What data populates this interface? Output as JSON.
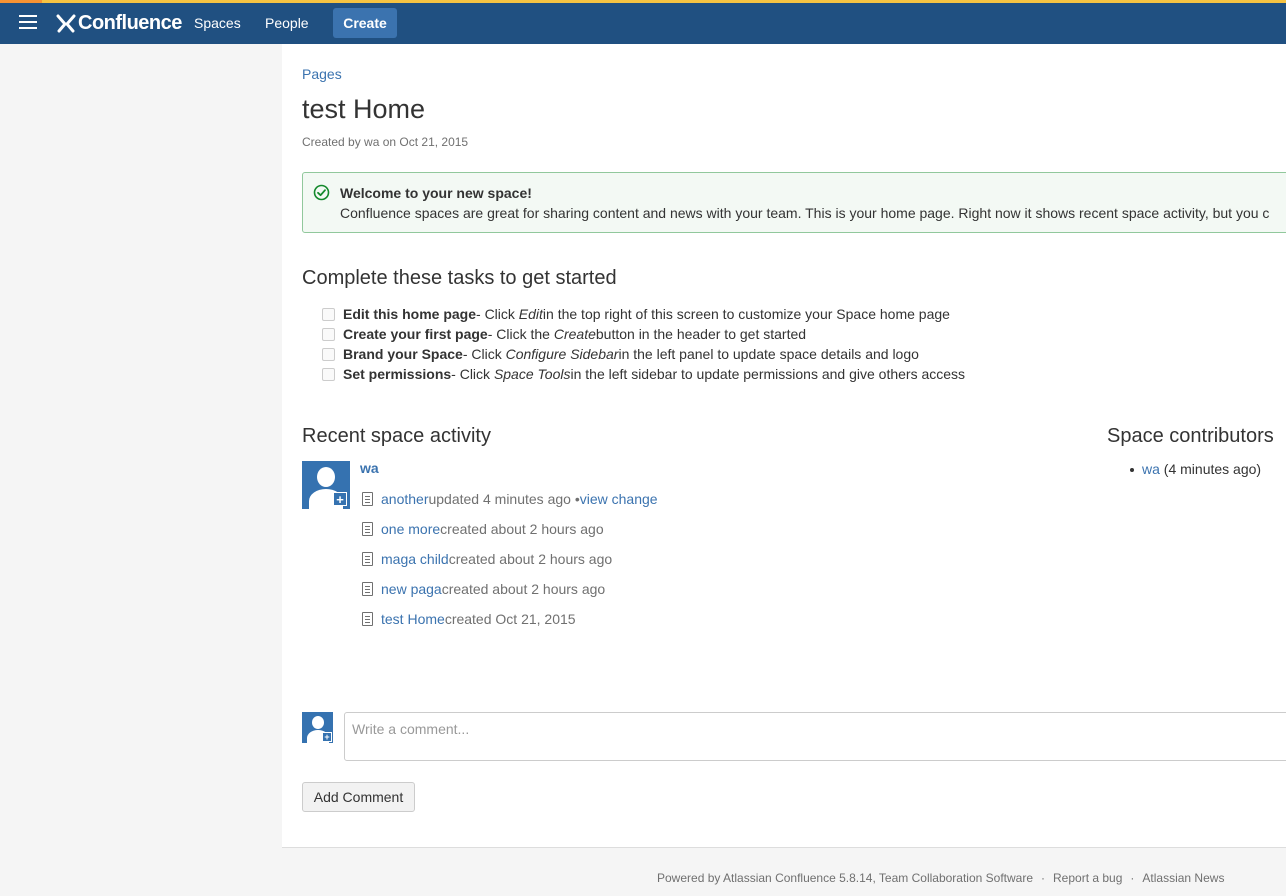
{
  "header": {
    "logo_text": "Confluence",
    "nav": [
      "Spaces",
      "People"
    ],
    "create_label": "Create"
  },
  "breadcrumb": "Pages",
  "page": {
    "title": "test Home",
    "meta": "Created by wa on Oct 21, 2015"
  },
  "welcome": {
    "title": "Welcome to your new space!",
    "body": "Confluence spaces are great for sharing content and news with your team. This is your home page. Right now it shows recent space activity, but you c"
  },
  "tasks": {
    "heading": "Complete these tasks to get started",
    "items": [
      {
        "bold": "Edit this home page",
        "pre": " - Click ",
        "em": "Edit",
        "post": " in the top right of this screen to customize your Space home page"
      },
      {
        "bold": "Create your first page",
        "pre": " - Click the ",
        "em": "Create",
        "post": " button in the header to get started"
      },
      {
        "bold": "Brand your Space",
        "pre": " - Click ",
        "em": "Configure Sidebar",
        "post": " in the left panel to update space details and logo"
      },
      {
        "bold": "Set permissions",
        "pre": " - Click ",
        "em": "Space Tools",
        "post": " in the left sidebar to update permissions and give others access"
      }
    ]
  },
  "activity": {
    "heading": "Recent space activity",
    "user": "wa",
    "items": [
      {
        "link": "another",
        "text": " updated 4 minutes ago • ",
        "extra_link": "view change"
      },
      {
        "link": "one more",
        "text": " created about 2 hours ago",
        "extra_link": ""
      },
      {
        "link": "maga child",
        "text": " created about 2 hours ago",
        "extra_link": ""
      },
      {
        "link": "new paga",
        "text": " created about 2 hours ago",
        "extra_link": ""
      },
      {
        "link": "test Home",
        "text": " created Oct 21, 2015",
        "extra_link": ""
      }
    ]
  },
  "contributors": {
    "heading": "Space contributors",
    "items": [
      {
        "name": "wa",
        "when": " (4 minutes ago)"
      }
    ]
  },
  "comment": {
    "placeholder": "Write a comment...",
    "button": "Add Comment"
  },
  "footer": {
    "powered": "Powered by Atlassian Confluence 5.8.14, Team Collaboration Software",
    "sep": "·",
    "report": "Report a bug",
    "news": "Atlassian News"
  },
  "colors": {
    "header_bg": "#205081",
    "link": "#3b73af",
    "create_bg": "#3b73af",
    "welcome_border": "#91c89c",
    "avatar_bg": "#3572b0"
  }
}
